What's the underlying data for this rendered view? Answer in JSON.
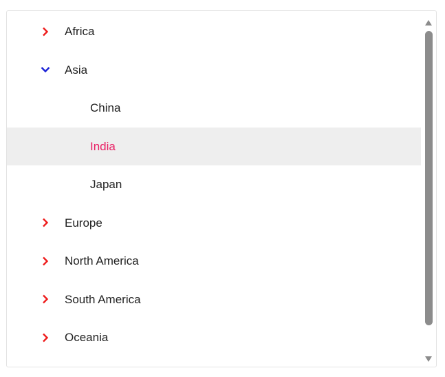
{
  "tree": {
    "continents": [
      {
        "label": "Africa",
        "expanded": false,
        "toggle_icon": "chevron-right-icon",
        "toggle_color": "#ee1c1c"
      },
      {
        "label": "Asia",
        "expanded": true,
        "toggle_icon": "chevron-down-icon",
        "toggle_color": "#1b22d6",
        "children": [
          {
            "label": "China",
            "selected": false
          },
          {
            "label": "India",
            "selected": true
          },
          {
            "label": "Japan",
            "selected": false
          }
        ]
      },
      {
        "label": "Europe",
        "expanded": false,
        "toggle_icon": "chevron-right-icon",
        "toggle_color": "#ee1c1c"
      },
      {
        "label": "North America",
        "expanded": false,
        "toggle_icon": "chevron-right-icon",
        "toggle_color": "#ee1c1c"
      },
      {
        "label": "South America",
        "expanded": false,
        "toggle_icon": "chevron-right-icon",
        "toggle_color": "#ee1c1c"
      },
      {
        "label": "Oceania",
        "expanded": false,
        "toggle_icon": "chevron-right-icon",
        "toggle_color": "#ee1c1c"
      }
    ]
  },
  "colors": {
    "text": "#222222",
    "selected_text": "#e91e63",
    "selected_background": "#eeeeee",
    "scroll_thumb": "#8c8c8c"
  }
}
